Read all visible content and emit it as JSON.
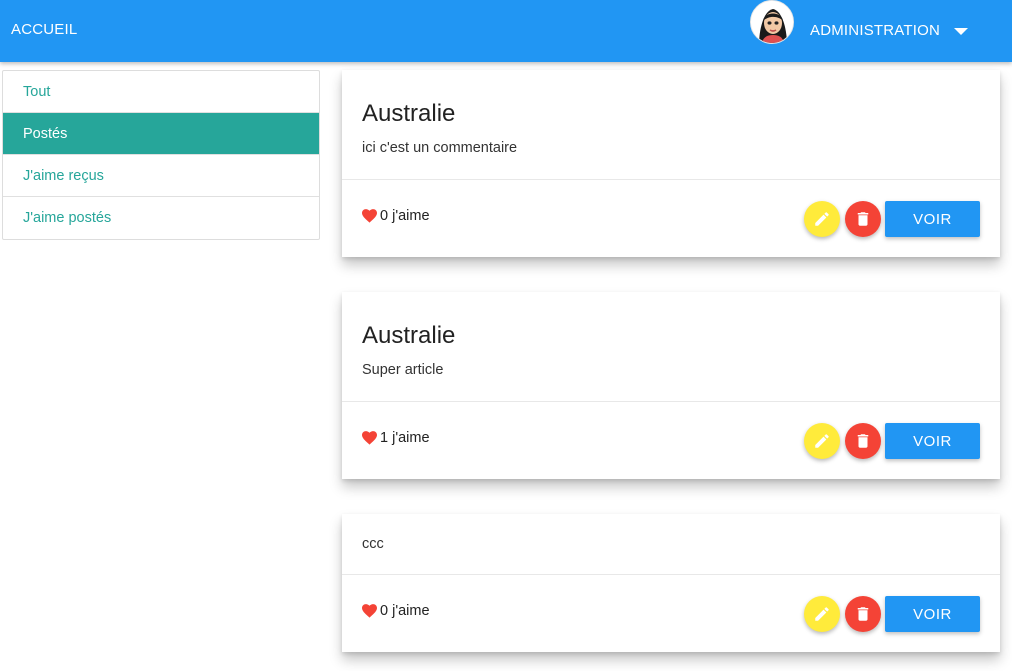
{
  "nav": {
    "brand": "ACCUEIL",
    "user_menu_label": "ADMINISTRATION",
    "avatar_alt": "avatar"
  },
  "sidebar": {
    "items": [
      {
        "label": "Tout",
        "active": false
      },
      {
        "label": "Postés",
        "active": true
      },
      {
        "label": "J'aime reçus",
        "active": false
      },
      {
        "label": "J'aime postés",
        "active": false
      }
    ]
  },
  "posts": [
    {
      "title": "Australie",
      "comment": "ici c'est un commentaire",
      "likes": "0 j'aime",
      "view_label": "VOIR"
    },
    {
      "title": "Australie",
      "comment": "Super article",
      "likes": "1 j'aime",
      "view_label": "VOIR"
    },
    {
      "title": "",
      "comment": "ccc",
      "likes": "0 j'aime",
      "view_label": "VOIR"
    }
  ],
  "colors": {
    "primary": "#2196f3",
    "teal": "#26a69a",
    "edit": "#ffeb3b",
    "delete": "#f44336",
    "heart": "#f44336"
  },
  "icons": {
    "edit": "pencil-icon",
    "delete": "trash-icon",
    "like": "heart-icon",
    "menu": "caret-down-icon"
  }
}
